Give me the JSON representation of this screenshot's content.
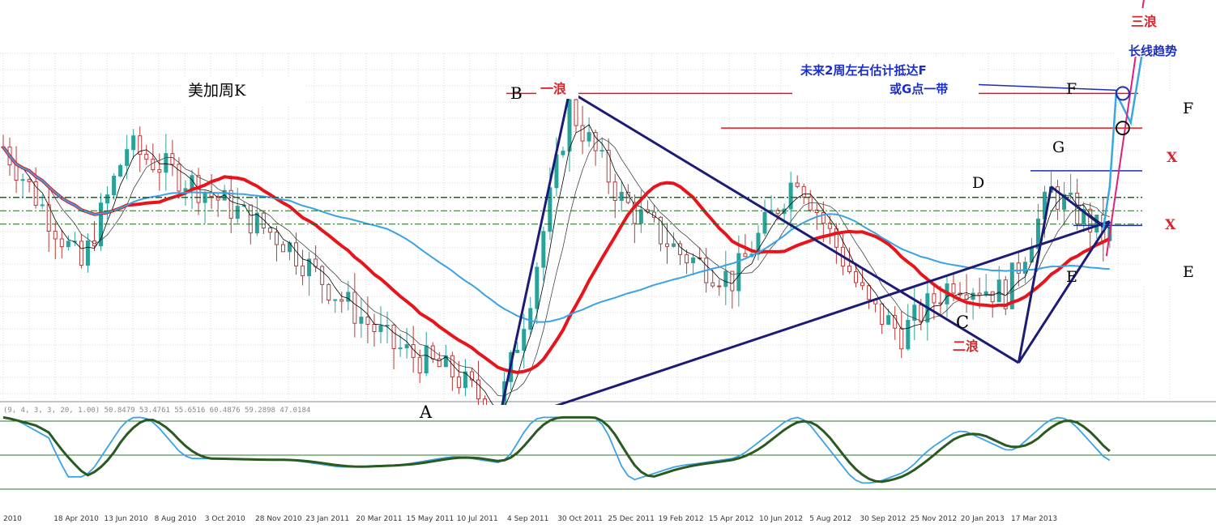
{
  "chart_data": {
    "type": "line",
    "title": "美加周K",
    "indicator_label": "(9, 4, 3, 3, 20, 1.00) 50.8479 53.4761 55.6516 60.4876 59.2898 47.0184",
    "x_tick_labels": [
      "2010",
      "18 Apr 2010",
      "13 Jun 2010",
      "8 Aug 2010",
      "3 Oct 2010",
      "28 Nov 2010",
      "23 Jan 2011",
      "20 Mar 2011",
      "15 May 2011",
      "10 Jul 2011",
      "4 Sep 2011",
      "30 Oct 2011",
      "25 Dec 2011",
      "19 Feb 2012",
      "15 Apr 2012",
      "10 Jun 2012",
      "5 Aug 2012",
      "30 Sep 2012",
      "25 Nov 2012",
      "20 Jan 2013",
      "17 Mar 2013"
    ],
    "ylim": [
      0.95,
      1.08
    ],
    "grid": true,
    "points": [
      {
        "label": "A",
        "date": "2011-07-17",
        "price": 0.9406
      },
      {
        "label": "B",
        "date": "2011-10-02",
        "price": 1.0658
      },
      {
        "label": "C",
        "date": "2013-01-27",
        "price": 0.964
      },
      {
        "label": "D",
        "date": "2013-03-03",
        "price": 1.03
      },
      {
        "label": "E",
        "date": "2013-04-28",
        "price": 1.015
      },
      {
        "label": "F",
        "date": "2013-05-19",
        "price": 1.065
      },
      {
        "label": "G",
        "date": "2013-05-19",
        "price": 1.052
      }
    ],
    "annotations": {
      "wave1": "一浪",
      "wave2": "二浪",
      "wave3": "三浪",
      "long_trend": "长线趋势",
      "forecast_line1": "未来2周左右估计抵达F",
      "forecast_line2": "或G点一带",
      "x_mark": "X",
      "right_label_F": "F",
      "right_label_E": "E"
    },
    "colors": {
      "ma_red": "#e8141c",
      "ma_blue": "#3aa2e6",
      "trend_navy": "#1c1c78",
      "candle_up": "#2aa29a",
      "candle_down": "#b83a3a",
      "wave_text": "#d8262c",
      "forecast_text": "#1c2fc8",
      "pink": "#e0207a",
      "osc_dark": "#2a5a20",
      "osc_blue": "#3aa2e6"
    }
  }
}
